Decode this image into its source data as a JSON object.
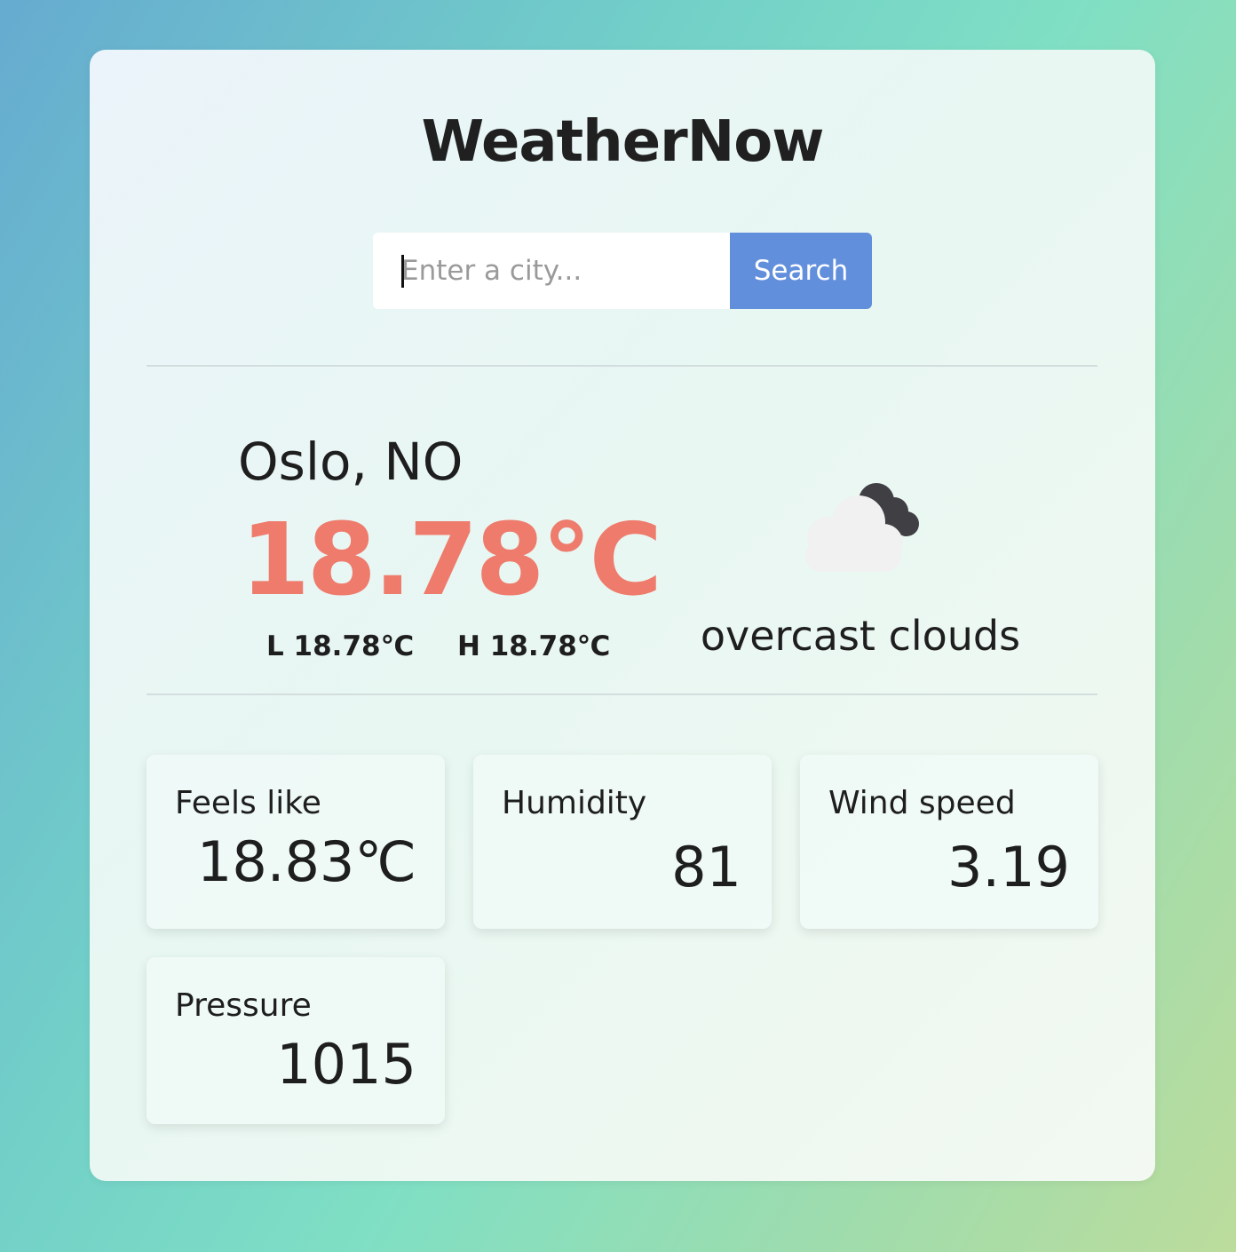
{
  "app": {
    "title": "WeatherNow"
  },
  "search": {
    "placeholder": "Enter a city...",
    "value": "",
    "button_label": "Search"
  },
  "current": {
    "location": "Oslo, NO",
    "temperature": "18.78℃",
    "low": "L 18.78℃",
    "high": "H 18.78℃",
    "description": "overcast clouds",
    "icon": "overcast-clouds-icon"
  },
  "stats": [
    {
      "label": "Feels like",
      "value": "18.83℃"
    },
    {
      "label": "Humidity",
      "value": "81"
    },
    {
      "label": "Wind speed",
      "value": "3.19"
    },
    {
      "label": "Pressure",
      "value": "1015"
    }
  ],
  "colors": {
    "accent": "#628fdc",
    "temperature": "#ee7b6c",
    "text": "#1e1e1e"
  }
}
